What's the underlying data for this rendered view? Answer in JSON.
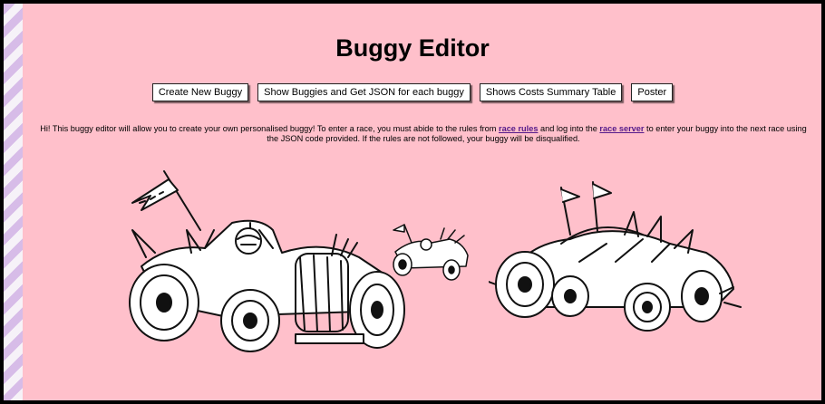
{
  "page": {
    "title": "Buggy Editor"
  },
  "buttons": {
    "create": "Create New Buggy",
    "show_json": "Show Buggies and Get JSON for each buggy",
    "costs": "Shows Costs Summary Table",
    "poster": "Poster"
  },
  "intro": {
    "part1": "Hi! This buggy editor will allow you to create your own personalised buggy! To enter a race, you must abide to the rules from",
    "link_rules": "race rules",
    "part2": "and log into the",
    "link_server": "race server",
    "part3": "to enter your buggy into the next race using the JSON code provided. If the rules are not followed, your buggy will be disqualified."
  },
  "illustrations": {
    "left": "buggy-sketch-large-left",
    "middle": "buggy-sketch-small",
    "right": "buggy-sketch-right"
  },
  "colors": {
    "background": "#ffc0cb",
    "border": "#000000",
    "stripe_a": "#d7bce8",
    "stripe_b": "#f6f2f8",
    "link": "#551a8b"
  }
}
